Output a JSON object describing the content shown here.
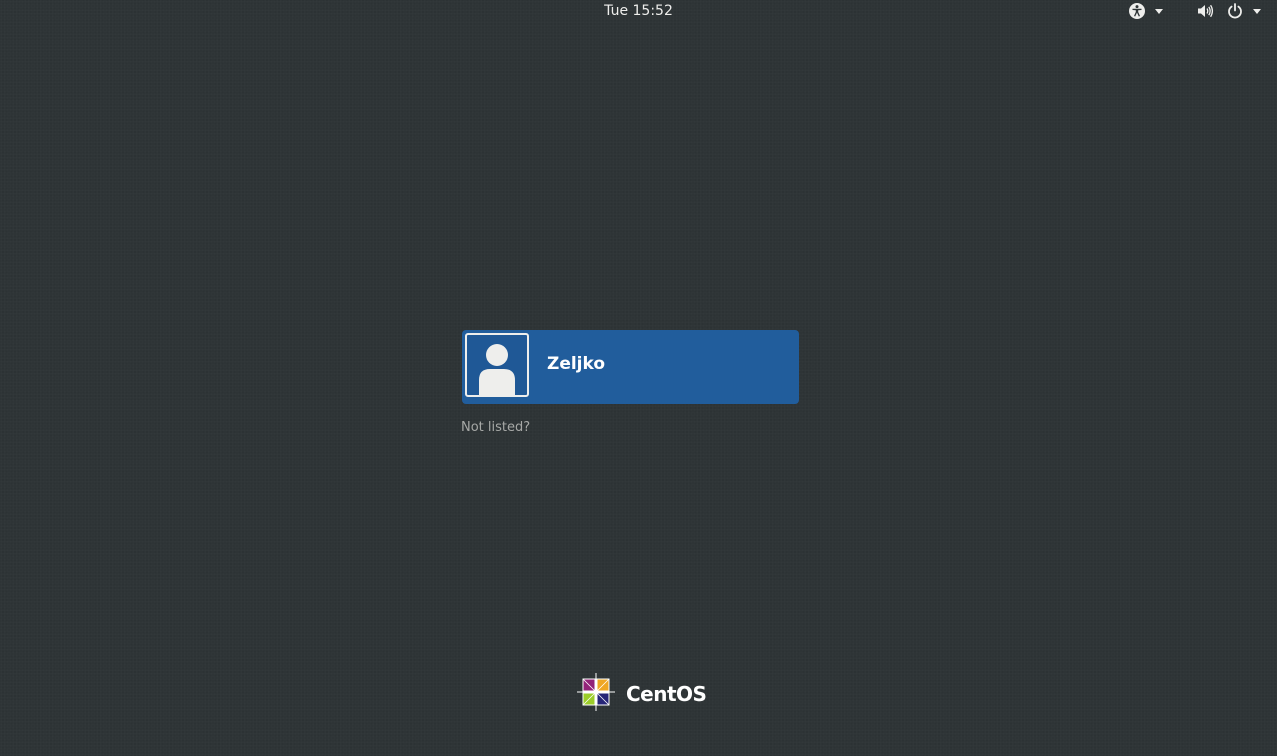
{
  "top_bar": {
    "clock": "Tue 15:52",
    "accessibility_icon": "accessibility-icon",
    "volume_icon": "volume-icon",
    "power_icon": "power-icon",
    "dropdown_icon": "chevron-down-icon"
  },
  "user_list": {
    "users": [
      {
        "name": "Zeljko",
        "avatar_icon": "user-avatar-icon",
        "selected": true
      }
    ],
    "not_listed_label": "Not listed?"
  },
  "branding": {
    "logo_text": "CentOS",
    "logo_icon": "centos-logo-icon"
  },
  "colors": {
    "background": "#2e3436",
    "selected_user_bg": "#215d9c",
    "text": "#eeeeec",
    "muted_text": "#a6a8a6"
  }
}
